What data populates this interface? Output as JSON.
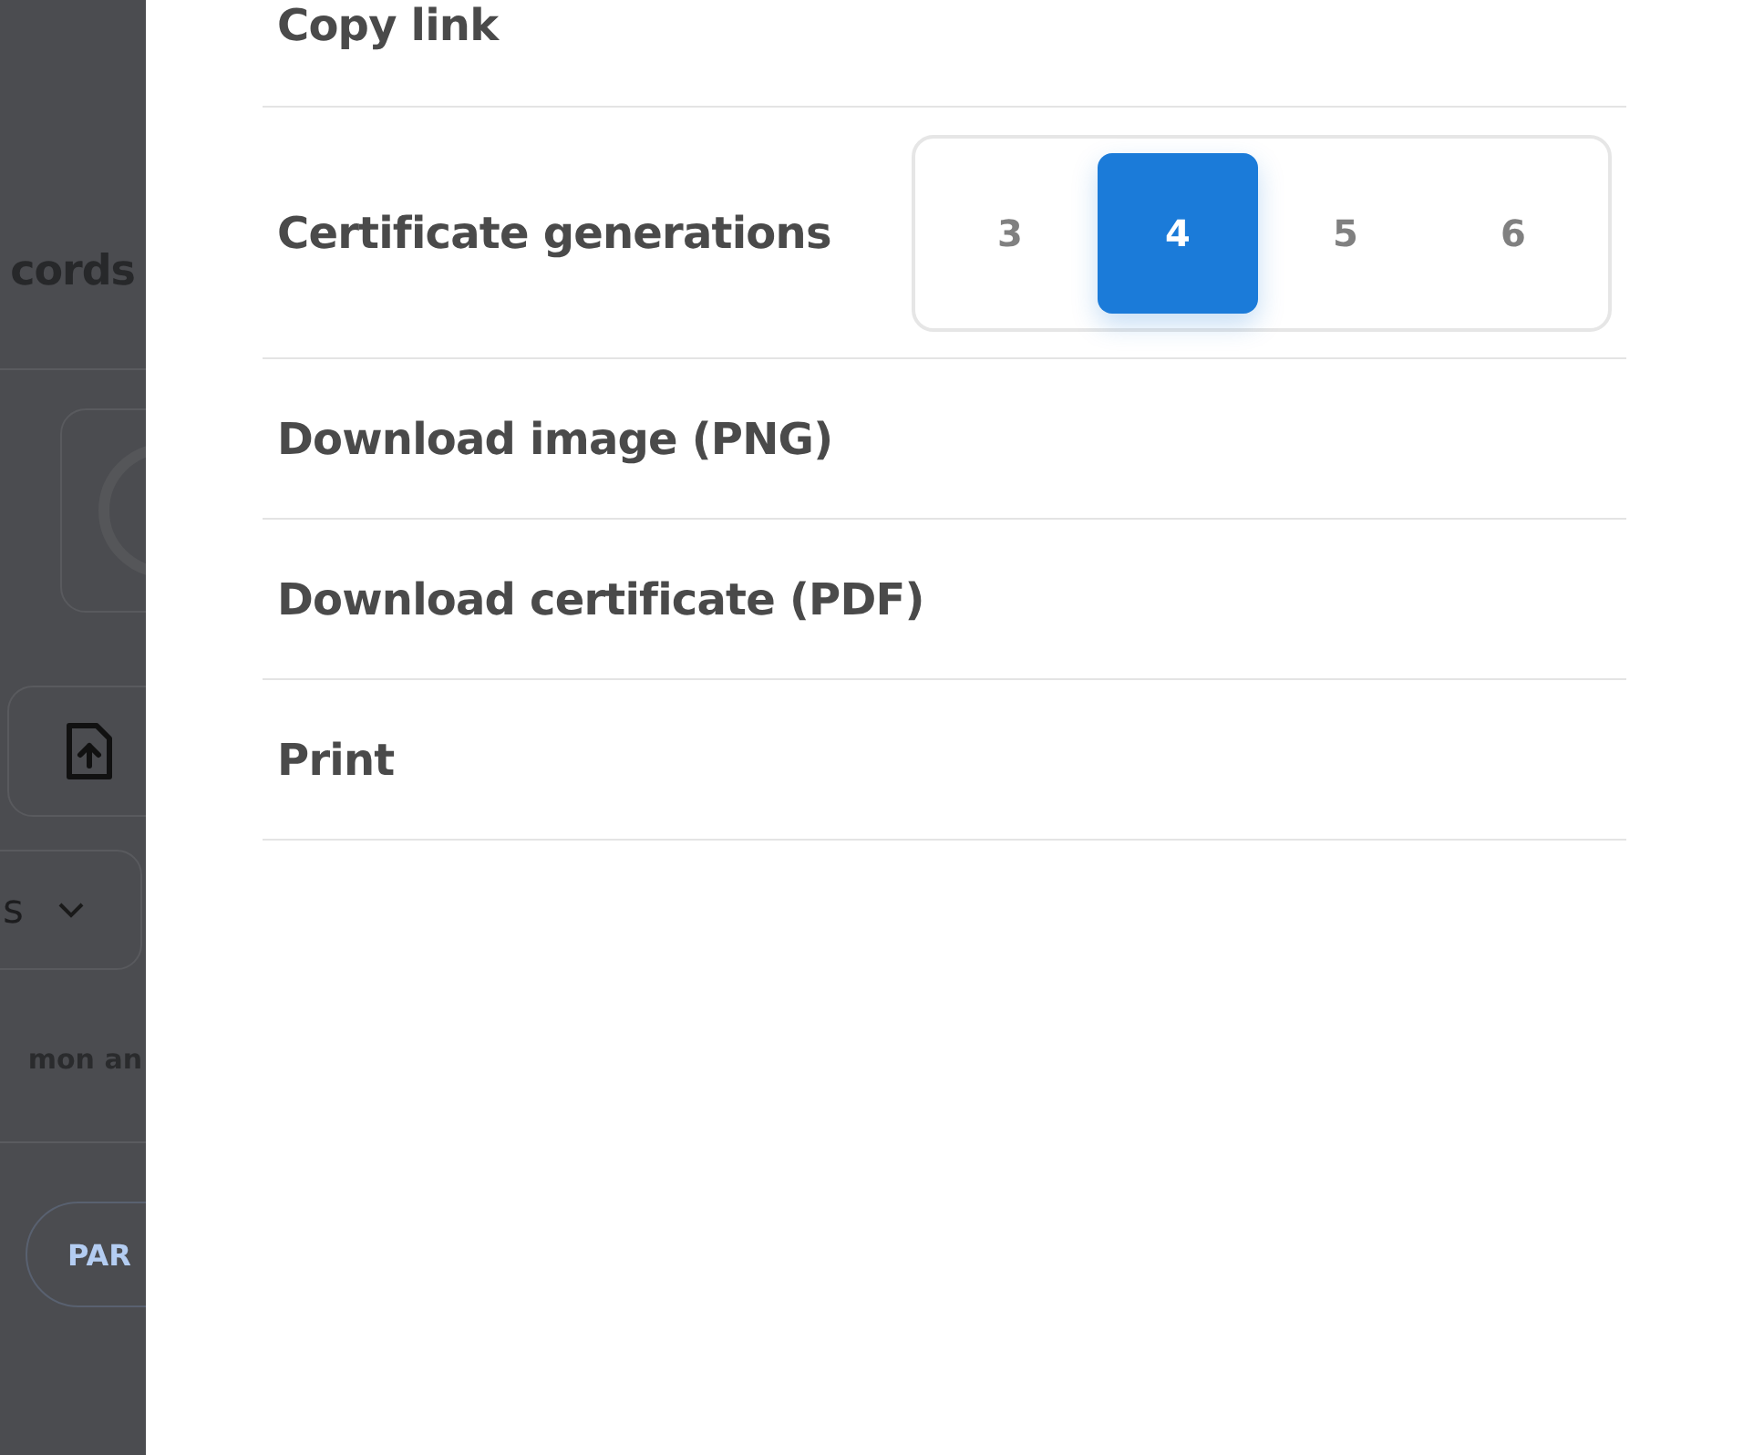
{
  "background": {
    "heading": "cords",
    "dropdown_label": "s",
    "text": "mon an",
    "pill": "PAR"
  },
  "menu": {
    "items": [
      {
        "kind": "action",
        "label": "Copy link"
      },
      {
        "kind": "segmented",
        "label": "Certificate generations",
        "options": [
          {
            "label": "3",
            "selected": false
          },
          {
            "label": "4",
            "selected": true
          },
          {
            "label": "5",
            "selected": false
          },
          {
            "label": "6",
            "selected": false
          }
        ]
      },
      {
        "kind": "action",
        "label": "Download image (PNG)"
      },
      {
        "kind": "action",
        "label": "Download certificate (PDF)"
      },
      {
        "kind": "action",
        "label": "Print"
      }
    ]
  }
}
